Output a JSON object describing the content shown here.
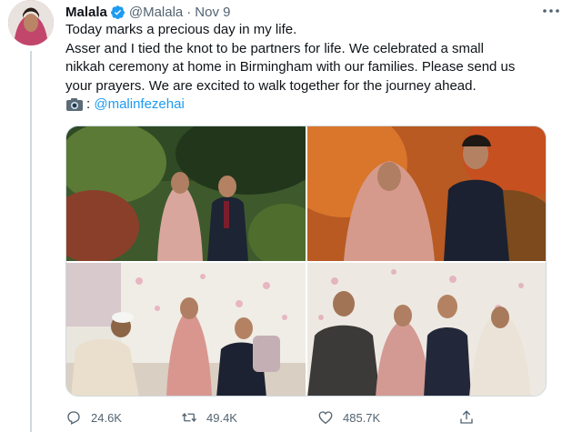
{
  "tweet": {
    "author_name": "Malala",
    "handle": "@Malala",
    "separator": "·",
    "date": "Nov 9",
    "lines": [
      "Today marks a precious day in my life.",
      "Asser and I tied the knot to be partners for life. We celebrated a small",
      "nikkah ceremony at home in Birmingham with our families. Please send us",
      "your prayers. We are excited to walk together for the journey ahead."
    ],
    "credit_separator": ":",
    "credit_mention": "@malinfezehai"
  },
  "media": {
    "photos": [
      {
        "id": "garden-couple"
      },
      {
        "id": "autumn-couple"
      },
      {
        "id": "nikkah-ceremony"
      },
      {
        "id": "family-group"
      }
    ]
  },
  "actions": {
    "reply_count": "24.6K",
    "retweet_count": "49.4K",
    "like_count": "485.7K"
  },
  "colors": {
    "accent": "#1d9bf0",
    "secondary_text": "#536471",
    "primary_text": "#0f1419"
  },
  "icons": [
    "verified-badge-icon",
    "more-icon",
    "camera-icon",
    "reply-icon",
    "retweet-icon",
    "like-icon",
    "share-icon"
  ]
}
